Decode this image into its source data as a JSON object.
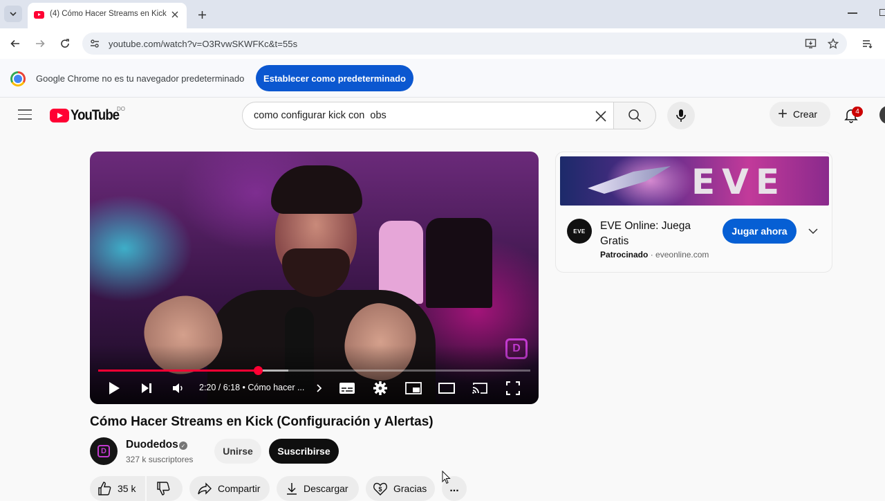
{
  "browser": {
    "tab": {
      "title": "(4) Cómo Hacer Streams en Kick"
    },
    "address_bar": {
      "url": "youtube.com/watch?v=O3RvwSKWFKc&t=55s"
    }
  },
  "infobar": {
    "message": "Google Chrome no es tu navegador predeterminado",
    "button_label": "Establecer como predeterminado"
  },
  "youtube": {
    "logo_text": "YouTube",
    "region": "DO",
    "search": {
      "query": "como configurar kick con  obs"
    },
    "create_label": "Crear",
    "notifications_count": "4"
  },
  "player": {
    "time": "2:20 / 6:18 • Cómo hacer ...",
    "progress_fraction": 0.37,
    "buffer_fraction": 0.44,
    "watermark": "D"
  },
  "video": {
    "title": "Cómo Hacer Streams en Kick (Configuración y Alertas)",
    "channel": {
      "name": "Duodedos",
      "subscribers": "327 k suscriptores",
      "avatar_letter": "D"
    },
    "join_label": "Unirse",
    "subscribe_label": "Suscribirse",
    "actions": {
      "likes": "35 k",
      "share": "Compartir",
      "download": "Descargar",
      "thanks": "Gracias",
      "more": "..."
    }
  },
  "ad": {
    "banner_text": "EVE",
    "icon_text": "EVE",
    "title": "EVE Online: Juega Gratis",
    "sponsored_label": "Patrocinado",
    "domain": "eveonline.com",
    "cta": "Jugar ahora"
  },
  "colors": {
    "accent_blue": "#065fd4",
    "chrome_blue": "#0b57d0",
    "youtube_red": "#ff0033"
  }
}
